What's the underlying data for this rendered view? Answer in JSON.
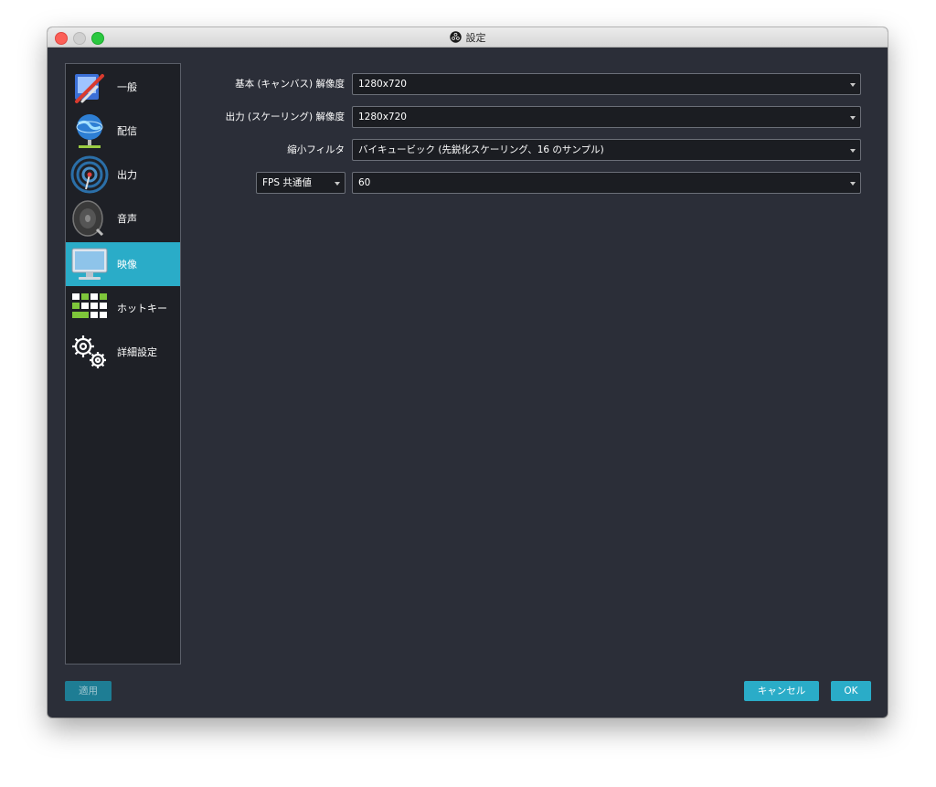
{
  "window": {
    "title": "設定"
  },
  "sidebar": {
    "items": [
      {
        "label": "一般",
        "icon": "general-tools-icon",
        "active": false
      },
      {
        "label": "配信",
        "icon": "stream-globe-icon",
        "active": false
      },
      {
        "label": "出力",
        "icon": "output-antenna-icon",
        "active": false
      },
      {
        "label": "音声",
        "icon": "audio-speaker-icon",
        "active": false
      },
      {
        "label": "映像",
        "icon": "video-monitor-icon",
        "active": true
      },
      {
        "label": "ホットキー",
        "icon": "hotkey-keyboard-icon",
        "active": false
      },
      {
        "label": "詳細設定",
        "icon": "advanced-gears-icon",
        "active": false
      }
    ]
  },
  "video": {
    "base_resolution": {
      "label": "基本 (キャンバス) 解像度",
      "value": "1280x720"
    },
    "output_resolution": {
      "label": "出力 (スケーリング) 解像度",
      "value": "1280x720"
    },
    "downscale_filter": {
      "label": "縮小フィルタ",
      "value": "バイキュービック (先鋭化スケーリング、16 のサンプル)"
    },
    "fps": {
      "type_value": "FPS 共通値",
      "value": "60"
    }
  },
  "buttons": {
    "apply": "適用",
    "cancel": "キャンセル",
    "ok": "OK"
  },
  "colors": {
    "accent": "#2aacc8",
    "background": "#2b2e38",
    "sidebar": "#1e2026"
  }
}
